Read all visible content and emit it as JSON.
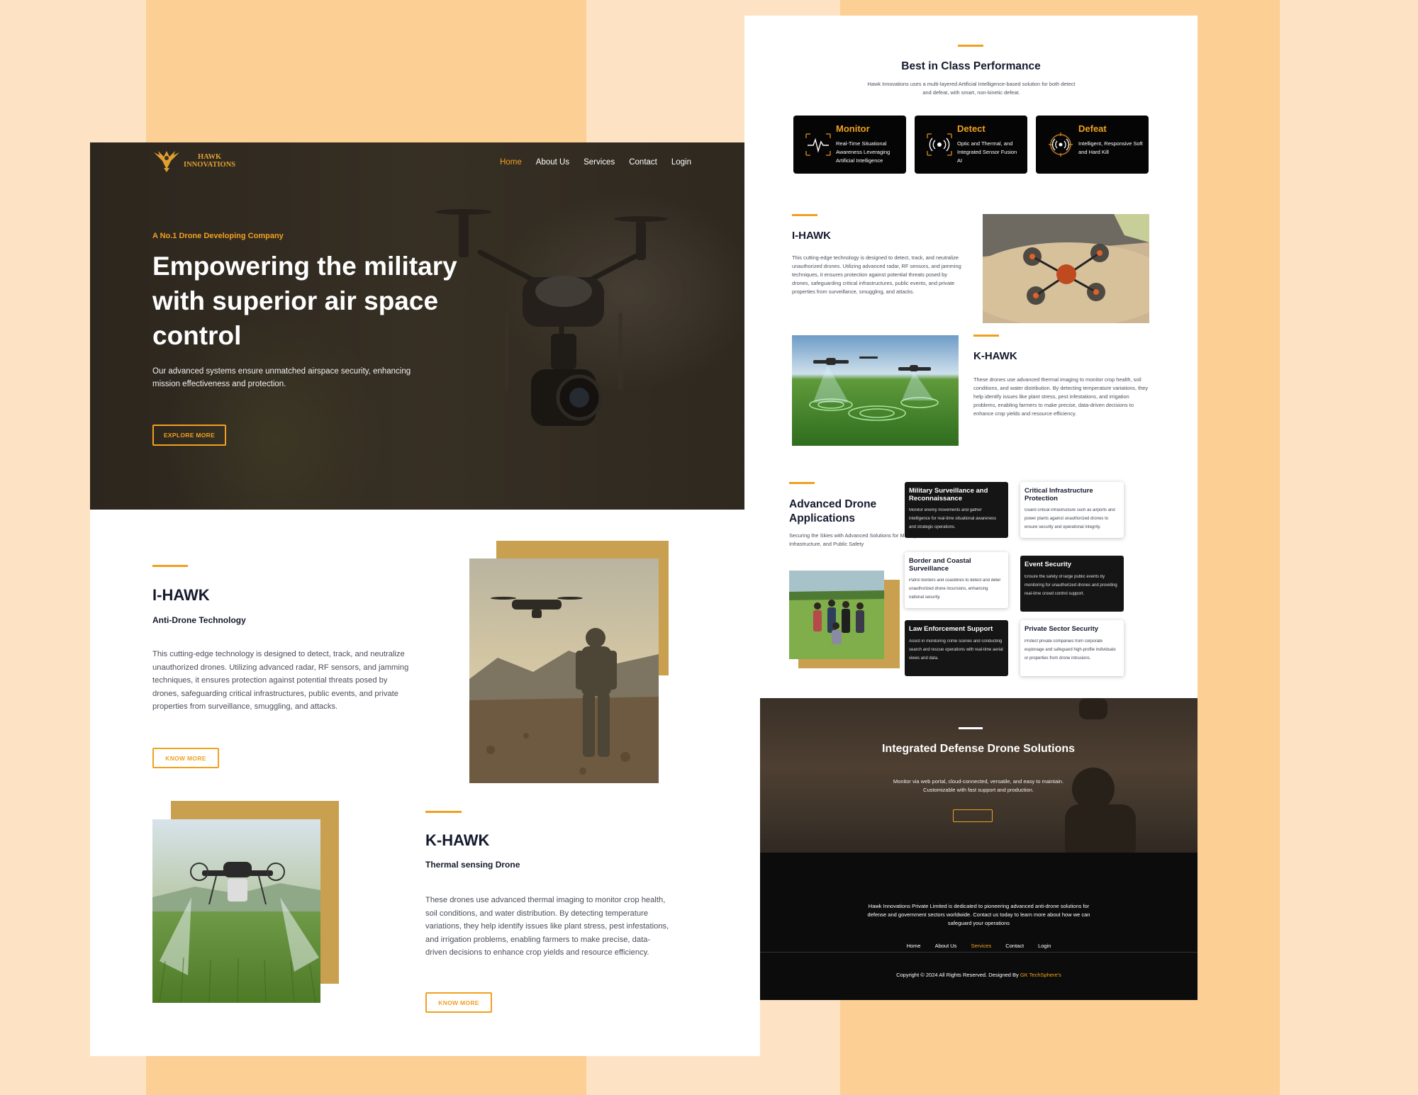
{
  "brand": {
    "name_line1": "HAWK",
    "name_line2": "INNOVATIONS"
  },
  "nav": {
    "home": "Home",
    "about": "About Us",
    "services": "Services",
    "contact": "Contact",
    "login": "Login"
  },
  "hero": {
    "tagline": "A No.1 Drone Developing Company",
    "title": "Empowering the military with superior air space control",
    "desc": "Our advanced systems ensure unmatched airspace security, enhancing mission effectiveness and protection.",
    "button": "EXPLORE MORE"
  },
  "ihawk": {
    "title": "I-HAWK",
    "subtitle": "Anti-Drone Technology",
    "desc": "This cutting-edge technology is designed to detect, track, and neutralize unauthorized drones. Utilizing advanced radar, RF sensors, and jamming techniques, it ensures protection against potential threats posed by drones, safeguarding critical infrastructures, public events, and private properties from surveillance, smuggling, and attacks.",
    "button": "KNOW MORE"
  },
  "khawk": {
    "title": "K-HAWK",
    "subtitle": "Thermal sensing Drone",
    "desc": "These drones use advanced thermal imaging to monitor crop health, soil conditions, and water distribution. By detecting temperature variations, they help identify issues like plant stress, pest infestations, and irrigation problems, enabling farmers to make precise, data-driven decisions to enhance crop yields and resource efficiency.",
    "button": "KNOW MORE"
  },
  "performance": {
    "title": "Best in Class Performance",
    "desc": "Hawk Innovations uses a multi-layered Artificial Intelligence-based solution for both detect and defeat, with smart, non-kinetic defeat.",
    "cards": [
      {
        "title": "Monitor",
        "icon": "waveform-icon",
        "desc": "Real-Time Situational Awareness Leveraging Artificial Intelligence"
      },
      {
        "title": "Detect",
        "icon": "radar-signal-icon",
        "desc": "Optic and Thermal, and Integrated Sensor Fusion AI"
      },
      {
        "title": "Defeat",
        "icon": "target-signal-icon",
        "desc": "Intelligent, Responsive Soft and Hard Kill"
      }
    ]
  },
  "applications": {
    "title": "Advanced Drone Applications",
    "desc": "Securing the Skies with Advanced Solutions for Military, Infrastructure, and Public Safety",
    "cards": [
      {
        "title": "Military Surveillance and Reconnaissance",
        "desc": "Monitor enemy movements and gather intelligence for real-time situational awareness and strategic operations.",
        "style": "dark"
      },
      {
        "title": "Critical Infrastructure Protection",
        "desc": "Guard critical infrastructure such as airports and power plants against unauthorized drones to ensure security and operational integrity.",
        "style": "light"
      },
      {
        "title": "Border and Coastal Surveillance",
        "desc": "Patrol borders and coastlines to detect and deter unauthorized drone incursions, enhancing national security.",
        "style": "light"
      },
      {
        "title": "Event Security",
        "desc": "Ensure the safety of large public events by monitoring for unauthorized drones and providing real-time crowd control support.",
        "style": "dark"
      },
      {
        "title": "Law Enforcement Support",
        "desc": "Assist in monitoring crime scenes and conducting search and rescue operations with real-time aerial views and data.",
        "style": "dark"
      },
      {
        "title": "Private Sector Security",
        "desc": "Protect private companies from corporate espionage and safeguard high-profile individuals or properties from drone intrusions.",
        "style": "light"
      }
    ]
  },
  "defense": {
    "title": "Integrated Defense Drone Solutions",
    "desc": "Monitor via web portal, cloud-connected, versatile, and easy to maintain. Customizable with fast support and production."
  },
  "footer": {
    "about": "Hawk Innovations Private Limited is dedicated to pioneering advanced anti-drone solutions for defense and government sectors worldwide. Contact us today to learn more about how we can safeguard your operations",
    "copyright": "Copyright © 2024 All Rights Reserved. Designed By",
    "designer": "GK TechSphere's"
  },
  "colors": {
    "accent": "#f0a020",
    "gold": "#c9a050",
    "navy": "#151a2d",
    "peach": "#fde3c4",
    "orange_stripe": "#fccf95"
  }
}
